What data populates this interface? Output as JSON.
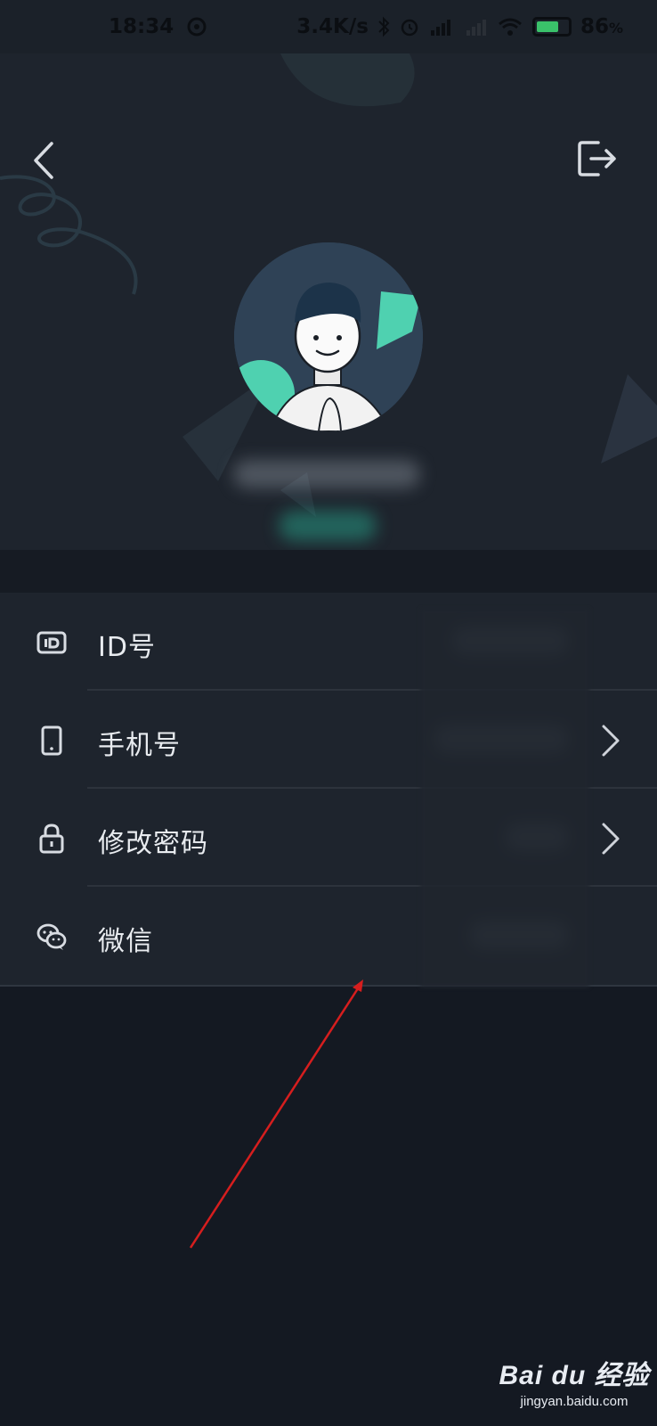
{
  "status_bar": {
    "time": "18:34",
    "net_speed": "3.4K/s",
    "battery": "86",
    "battery_unit": "%"
  },
  "header": {
    "back_icon": "chevron-left-icon",
    "logout_icon": "logout-icon",
    "avatar_icon": "cartoon-avatar",
    "name_redacted": "",
    "tag_redacted": ""
  },
  "settings": {
    "items": [
      {
        "label": "ID号",
        "icon": "id-card-icon",
        "value": "",
        "has_chevron": false
      },
      {
        "label": "手机号",
        "icon": "phone-icon",
        "value": "",
        "has_chevron": true
      },
      {
        "label": "修改密码",
        "icon": "lock-icon",
        "value": "",
        "has_chevron": true
      },
      {
        "label": "微信",
        "icon": "wechat-icon",
        "value": "",
        "has_chevron": false
      }
    ]
  },
  "watermark": {
    "brand": "Bai du 经验",
    "url": "jingyan.baidu.com"
  },
  "colors": {
    "background": "#141922",
    "header_bg": "#1e242d",
    "accent_green": "#4fd1b0",
    "annotation_red": "#d61e1e"
  }
}
